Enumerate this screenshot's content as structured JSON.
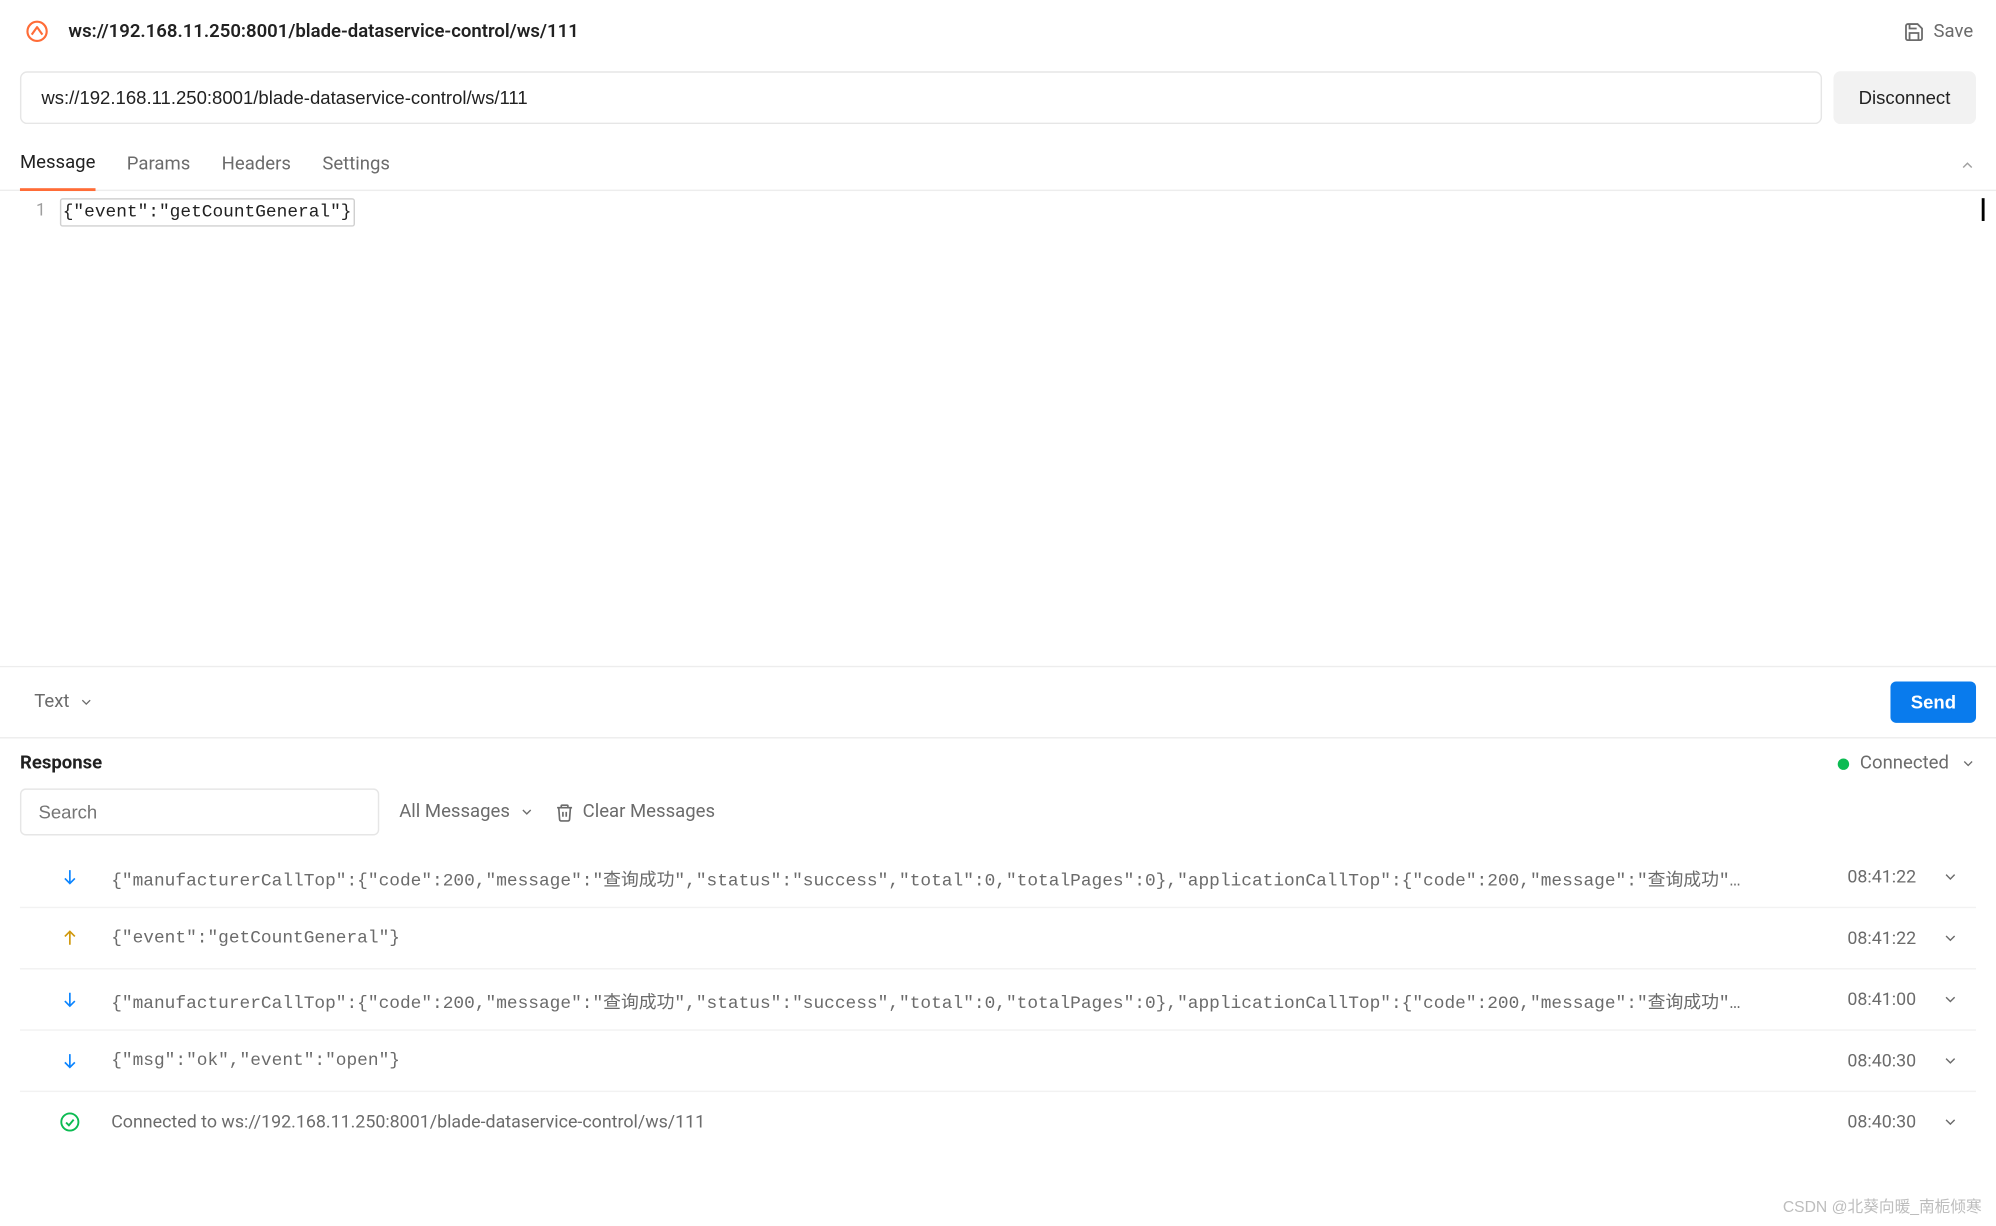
{
  "header": {
    "title": "ws://192.168.11.250:8001/blade-dataservice-control/ws/111",
    "save_label": "Save"
  },
  "url_bar": {
    "value": "ws://192.168.11.250:8001/blade-dataservice-control/ws/111",
    "disconnect_label": "Disconnect"
  },
  "tabs": {
    "items": [
      {
        "label": "Message"
      },
      {
        "label": "Params"
      },
      {
        "label": "Headers"
      },
      {
        "label": "Settings"
      }
    ]
  },
  "editor": {
    "line_number": "1",
    "line_content": "{\"event\":\"getCountGeneral\"}"
  },
  "editor_footer": {
    "format_label": "Text",
    "send_label": "Send"
  },
  "response": {
    "title": "Response",
    "status_label": "Connected",
    "search_placeholder": "Search",
    "filter_label": "All Messages",
    "clear_label": "Clear Messages",
    "messages": [
      {
        "direction": "incoming",
        "content": "{\"manufacturerCallTop\":{\"code\":200,\"message\":\"查询成功\",\"status\":\"success\",\"total\":0,\"totalPages\":0},\"applicationCallTop\":{\"code\":200,\"message\":\"查询成功\"…",
        "time": "08:41:22"
      },
      {
        "direction": "outgoing",
        "content": "{\"event\":\"getCountGeneral\"}",
        "time": "08:41:22"
      },
      {
        "direction": "incoming",
        "content": "{\"manufacturerCallTop\":{\"code\":200,\"message\":\"查询成功\",\"status\":\"success\",\"total\":0,\"totalPages\":0},\"applicationCallTop\":{\"code\":200,\"message\":\"查询成功\"…",
        "time": "08:41:00"
      },
      {
        "direction": "incoming",
        "content": "{\"msg\":\"ok\",\"event\":\"open\"}",
        "time": "08:40:30"
      },
      {
        "direction": "connected",
        "content": "Connected to ws://192.168.11.250:8001/blade-dataservice-control/ws/111",
        "time": "08:40:30"
      }
    ]
  },
  "watermark": "CSDN @北葵向暖_南栀倾寒"
}
